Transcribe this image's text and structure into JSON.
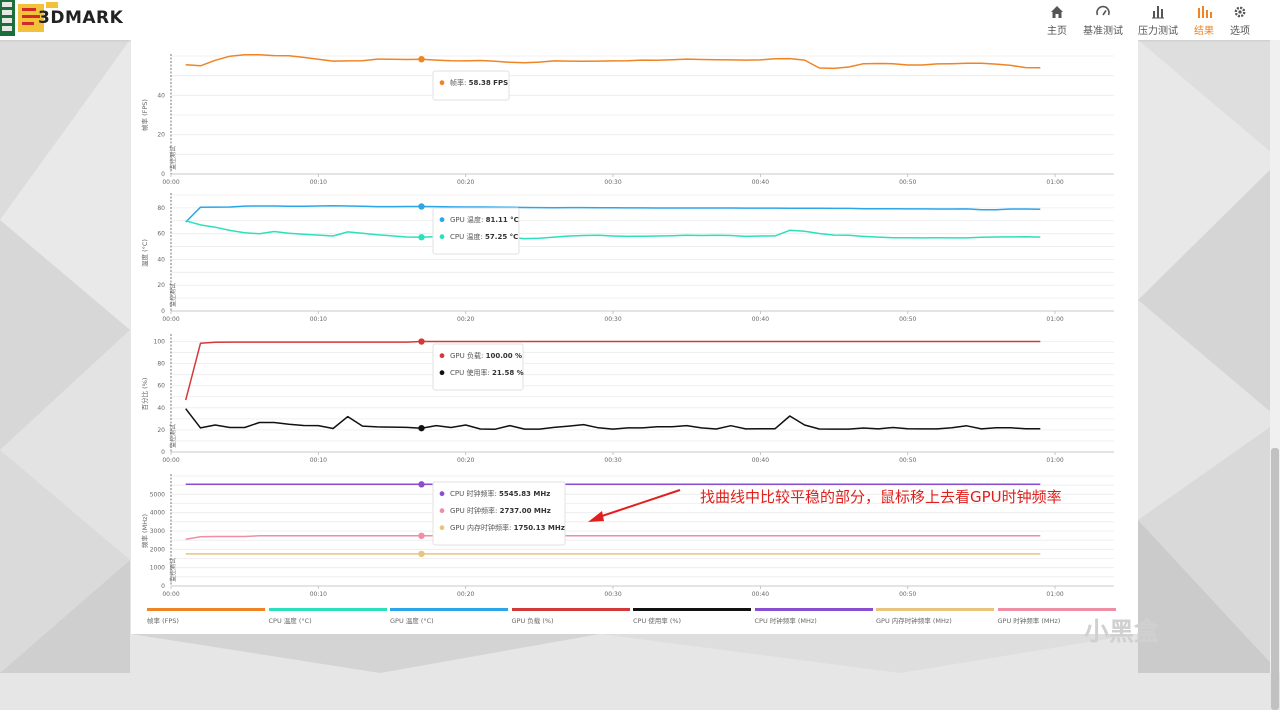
{
  "brand": {
    "name": "3DMARK"
  },
  "nav": [
    {
      "label": "主页",
      "icon": "home-icon"
    },
    {
      "label": "基准测试",
      "icon": "gauge-icon"
    },
    {
      "label": "压力测试",
      "icon": "bar-chart-icon"
    },
    {
      "label": "结果",
      "icon": "results-icon",
      "active": true
    },
    {
      "label": "选项",
      "icon": "gear-icon"
    }
  ],
  "colors": {
    "accent": "#ef8424",
    "fps": "#ef8424",
    "gpu_temp": "#2ba6e8",
    "cpu_temp": "#2de0bc",
    "gpu_load": "#d23a3a",
    "cpu_usage": "#111111",
    "cpu_clock": "#8a4fd0",
    "gpu_mem_clock": "#e8c47e",
    "gpu_clock": "#ee8fa6",
    "annotation": "#e0201c"
  },
  "annotation": "找曲线中比较平稳的部分，鼠标移上去看GPU时钟频率",
  "watermark": "小黑盒",
  "chart_data": [
    {
      "type": "line",
      "ylabel": "帧率 (FPS)",
      "ylim": [
        0,
        60
      ],
      "yticks": [
        0,
        20,
        40
      ],
      "marker_label": "监控测试",
      "xlim": [
        0,
        64
      ],
      "xticks": [
        0,
        10,
        20,
        30,
        40,
        50,
        60
      ],
      "xtick_labels": [
        "00:00",
        "00:10",
        "00:20",
        "00:30",
        "00:40",
        "00:50",
        "01:00"
      ],
      "series": [
        {
          "name": "帧率",
          "color": "#ef8424",
          "x": [
            1,
            2,
            3,
            4,
            5,
            6,
            7,
            8,
            9,
            10,
            11,
            12,
            13,
            14,
            15,
            16,
            17,
            18,
            19,
            20,
            21,
            22,
            23,
            24,
            25,
            26,
            27,
            28,
            29,
            30,
            31,
            32,
            33,
            34,
            35,
            36,
            37,
            38,
            39,
            40,
            41,
            42,
            43,
            44,
            45,
            46,
            47,
            48,
            49,
            50,
            51,
            52,
            53,
            54,
            55,
            56,
            57,
            58,
            59
          ],
          "y": [
            55.5,
            55,
            57.8,
            59.9,
            60.6,
            60.6,
            60.2,
            60.1,
            59.3,
            58.3,
            57.4,
            57.5,
            57.6,
            58.4,
            58.3,
            58.2,
            58.38,
            57.9,
            57.6,
            57.5,
            57.7,
            57.3,
            56.8,
            56.6,
            56.9,
            57.5,
            57.4,
            57.3,
            57.4,
            57.5,
            57.6,
            57.9,
            57.8,
            58.1,
            58.4,
            58.2,
            58.1,
            58,
            57.9,
            58,
            58.6,
            58.7,
            57.9,
            53.9,
            53.7,
            54.4,
            56.1,
            56.2,
            56.1,
            55.4,
            55.4,
            56,
            56.1,
            56.3,
            56.3,
            55.9,
            55.2,
            54.1,
            54
          ]
        }
      ],
      "hover_x": 17,
      "tooltip": [
        {
          "label": "帧率: ",
          "value": "58.38 FPS"
        }
      ]
    },
    {
      "type": "line",
      "ylabel": "温度 (°C)",
      "ylim": [
        0,
        90
      ],
      "yticks": [
        0,
        20,
        40,
        60,
        80
      ],
      "marker_label": "监控测试",
      "xlim": [
        0,
        64
      ],
      "xticks": [
        0,
        10,
        20,
        30,
        40,
        50,
        60
      ],
      "xtick_labels": [
        "00:00",
        "00:10",
        "00:20",
        "00:30",
        "00:40",
        "00:50",
        "01:00"
      ],
      "series": [
        {
          "name": "GPU 温度",
          "color": "#2ba6e8",
          "x": [
            1,
            2,
            3,
            4,
            5,
            6,
            7,
            8,
            9,
            10,
            11,
            12,
            13,
            14,
            15,
            16,
            17,
            18,
            19,
            20,
            21,
            22,
            23,
            24,
            25,
            26,
            27,
            28,
            29,
            30,
            31,
            32,
            33,
            34,
            35,
            36,
            37,
            38,
            39,
            40,
            41,
            42,
            43,
            44,
            45,
            46,
            47,
            48,
            49,
            50,
            51,
            52,
            53,
            54,
            55,
            56,
            57,
            58,
            59
          ],
          "y": [
            69,
            80.5,
            80.6,
            80.7,
            81.4,
            81.5,
            81.5,
            81.3,
            81.3,
            81.5,
            81.6,
            81.5,
            81.2,
            81,
            81,
            81.1,
            81.11,
            81,
            80.8,
            80.7,
            80.7,
            80.6,
            80.5,
            80.3,
            80.2,
            80.1,
            80.2,
            80.2,
            80.1,
            80.1,
            80,
            80,
            79.9,
            79.9,
            79.9,
            79.9,
            79.9,
            79.9,
            79.8,
            79.8,
            79.8,
            79.7,
            79.7,
            79.7,
            79.6,
            79.6,
            79.4,
            79.4,
            79.3,
            79.2,
            79.2,
            79.1,
            79.1,
            79.2,
            78.5,
            78.5,
            79.1,
            79.1,
            79
          ]
        },
        {
          "name": "CPU 温度",
          "color": "#2de0bc",
          "x": [
            1,
            2,
            3,
            4,
            5,
            6,
            7,
            8,
            9,
            10,
            11,
            12,
            13,
            14,
            15,
            16,
            17,
            18,
            19,
            20,
            21,
            22,
            23,
            24,
            25,
            26,
            27,
            28,
            29,
            30,
            31,
            32,
            33,
            34,
            35,
            36,
            37,
            38,
            39,
            40,
            41,
            42,
            43,
            44,
            45,
            46,
            47,
            48,
            49,
            50,
            51,
            52,
            53,
            54,
            55,
            56,
            57,
            58,
            59
          ],
          "y": [
            70,
            66.8,
            65,
            62.5,
            60.7,
            59.9,
            61.7,
            60.4,
            59.6,
            58.9,
            58.2,
            61.4,
            60.3,
            59.2,
            58.3,
            57.4,
            57.25,
            57.7,
            58.1,
            57.8,
            57.1,
            56.9,
            57,
            56.2,
            56.5,
            57.3,
            58.2,
            58.6,
            58.7,
            58.2,
            57.9,
            58,
            58.2,
            58.4,
            58.8,
            58.6,
            58.7,
            58.6,
            57.9,
            58.2,
            58.3,
            62.6,
            61.8,
            60.1,
            58.9,
            58.7,
            57.9,
            57.3,
            56.9,
            56.8,
            56.7,
            56.8,
            56.7,
            56.7,
            57.2,
            57.4,
            57.5,
            57.6,
            57.3
          ]
        }
      ],
      "hover_x": 17,
      "tooltip": [
        {
          "label": "GPU 温度: ",
          "value": "81.11 °C"
        },
        {
          "label": "CPU 温度: ",
          "value": "57.25 °C"
        }
      ]
    },
    {
      "type": "line",
      "ylabel": "百分比 (%)",
      "ylim": [
        0,
        105
      ],
      "yticks": [
        0,
        20,
        40,
        60,
        80,
        100
      ],
      "marker_label": "监控测试",
      "xlim": [
        0,
        64
      ],
      "xticks": [
        0,
        10,
        20,
        30,
        40,
        50,
        60
      ],
      "xtick_labels": [
        "00:00",
        "00:10",
        "00:20",
        "00:30",
        "00:40",
        "00:50",
        "01:00"
      ],
      "series": [
        {
          "name": "GPU 负载",
          "color": "#d23a3a",
          "x": [
            1,
            2,
            3,
            4,
            5,
            6,
            7,
            8,
            9,
            10,
            11,
            12,
            13,
            14,
            15,
            16,
            17,
            18,
            19,
            20,
            21,
            22,
            23,
            24,
            25,
            26,
            27,
            28,
            29,
            30,
            31,
            32,
            33,
            34,
            35,
            36,
            37,
            38,
            39,
            40,
            41,
            42,
            43,
            44,
            45,
            46,
            47,
            48,
            49,
            50,
            51,
            52,
            53,
            54,
            55,
            56,
            57,
            58,
            59
          ],
          "y": [
            47,
            98.5,
            99.4,
            99.5,
            99.5,
            99.5,
            99.5,
            99.5,
            99.5,
            99.5,
            99.5,
            99.5,
            99.5,
            99.5,
            99.5,
            99.5,
            100,
            100,
            100,
            100,
            100,
            100,
            100,
            100,
            100,
            100,
            100,
            100,
            100,
            100,
            100,
            100,
            100,
            100,
            100,
            100,
            100,
            100,
            100,
            100,
            100,
            100,
            100,
            100,
            100,
            100,
            100,
            100,
            100,
            100,
            100,
            100,
            100,
            100,
            100,
            100,
            100,
            100,
            100
          ]
        },
        {
          "name": "CPU 使用率",
          "color": "#111111",
          "x": [
            1,
            2,
            3,
            4,
            5,
            6,
            7,
            8,
            9,
            10,
            11,
            12,
            13,
            14,
            15,
            16,
            17,
            18,
            19,
            20,
            21,
            22,
            23,
            24,
            25,
            26,
            27,
            28,
            29,
            30,
            31,
            32,
            33,
            34,
            35,
            36,
            37,
            38,
            39,
            40,
            41,
            42,
            43,
            44,
            45,
            46,
            47,
            48,
            49,
            50,
            51,
            52,
            53,
            54,
            55,
            56,
            57,
            58,
            59
          ],
          "y": [
            39.2,
            21.8,
            24.4,
            22.2,
            22.2,
            26.7,
            26.7,
            25.2,
            24,
            23.9,
            21.3,
            32,
            23.4,
            22.7,
            22.5,
            22.3,
            21.58,
            23.9,
            22.2,
            24.4,
            20.8,
            20.6,
            23.9,
            20.7,
            20.7,
            22.3,
            23.4,
            24.8,
            21.9,
            20.7,
            21.8,
            21.8,
            22.8,
            22.9,
            23.9,
            21.8,
            20.8,
            23.8,
            20.9,
            21,
            21.1,
            32.6,
            24.4,
            20.8,
            20.7,
            20.7,
            21.7,
            20.9,
            22.2,
            21,
            20.9,
            20.9,
            21.9,
            23.7,
            20.9,
            21.9,
            21.9,
            21,
            21
          ]
        }
      ],
      "hover_x": 17,
      "tooltip": [
        {
          "label": "GPU 负载: ",
          "value": "100.00 %"
        },
        {
          "label": "CPU 使用率: ",
          "value": "21.58 %"
        }
      ]
    },
    {
      "type": "line",
      "ylabel": "频率 (MHz)",
      "ylim": [
        0,
        6000
      ],
      "yticks": [
        0,
        1000,
        2000,
        3000,
        4000,
        5000
      ],
      "marker_label": "监控测试",
      "xlim": [
        0,
        64
      ],
      "xticks": [
        0,
        10,
        20,
        30,
        40,
        50,
        60
      ],
      "xtick_labels": [
        "00:00",
        "00:10",
        "00:20",
        "00:30",
        "00:40",
        "00:50",
        "01:00"
      ],
      "series": [
        {
          "name": "CPU 时钟频率",
          "color": "#8a4fd0",
          "x": [
            1,
            59
          ],
          "y": [
            5545.83,
            5545.83
          ]
        },
        {
          "name": "GPU 时钟频率",
          "color": "#ee8fa6",
          "x": [
            1,
            2,
            3,
            4,
            5,
            6,
            7,
            8,
            9,
            10,
            11,
            12,
            13,
            14,
            15,
            16,
            17,
            18,
            19,
            20,
            21,
            22,
            23,
            24,
            25,
            26,
            27,
            28,
            29,
            30,
            31,
            32,
            33,
            34,
            35,
            36,
            37,
            38,
            39,
            40,
            41,
            42,
            43,
            44,
            45,
            46,
            47,
            48,
            49,
            50,
            51,
            52,
            53,
            54,
            55,
            56,
            57,
            58,
            59
          ],
          "y": [
            2550,
            2690,
            2700,
            2700,
            2700,
            2737,
            2737,
            2737,
            2737,
            2737,
            2737,
            2737,
            2737,
            2737,
            2737,
            2737,
            2737,
            2737,
            2737,
            2737,
            2737,
            2737,
            2737,
            2737,
            2737,
            2737,
            2737,
            2737,
            2737,
            2737,
            2737,
            2737,
            2737,
            2737,
            2737,
            2737,
            2737,
            2737,
            2737,
            2737,
            2737,
            2737,
            2737,
            2737,
            2737,
            2737,
            2737,
            2737,
            2737,
            2737,
            2737,
            2737,
            2737,
            2737,
            2737,
            2737,
            2737,
            2737,
            2737
          ]
        },
        {
          "name": "GPU 内存时钟频率",
          "color": "#e8c47e",
          "x": [
            1,
            59
          ],
          "y": [
            1750.13,
            1750.13
          ]
        }
      ],
      "hover_x": 17,
      "tooltip": [
        {
          "label": "CPU 时钟频率: ",
          "value": "5545.83 MHz"
        },
        {
          "label": "GPU 时钟频率: ",
          "value": "2737.00 MHz"
        },
        {
          "label": "GPU 内存时钟频率: ",
          "value": "1750.13 MHz"
        }
      ]
    }
  ],
  "legend": [
    {
      "label": "帧率 (FPS)",
      "color": "#ef8424"
    },
    {
      "label": "CPU 温度 (°C)",
      "color": "#2de0bc"
    },
    {
      "label": "GPU 温度 (°C)",
      "color": "#2ba6e8"
    },
    {
      "label": "GPU 负载 (%)",
      "color": "#d23a3a"
    },
    {
      "label": "CPU 使用率 (%)",
      "color": "#111111"
    },
    {
      "label": "CPU 时钟频率 (MHz)",
      "color": "#8a4fd0"
    },
    {
      "label": "GPU 内存时钟频率 (MHz)",
      "color": "#e8c47e"
    },
    {
      "label": "GPU 时钟频率 (MHz)",
      "color": "#ee8fa6"
    }
  ]
}
